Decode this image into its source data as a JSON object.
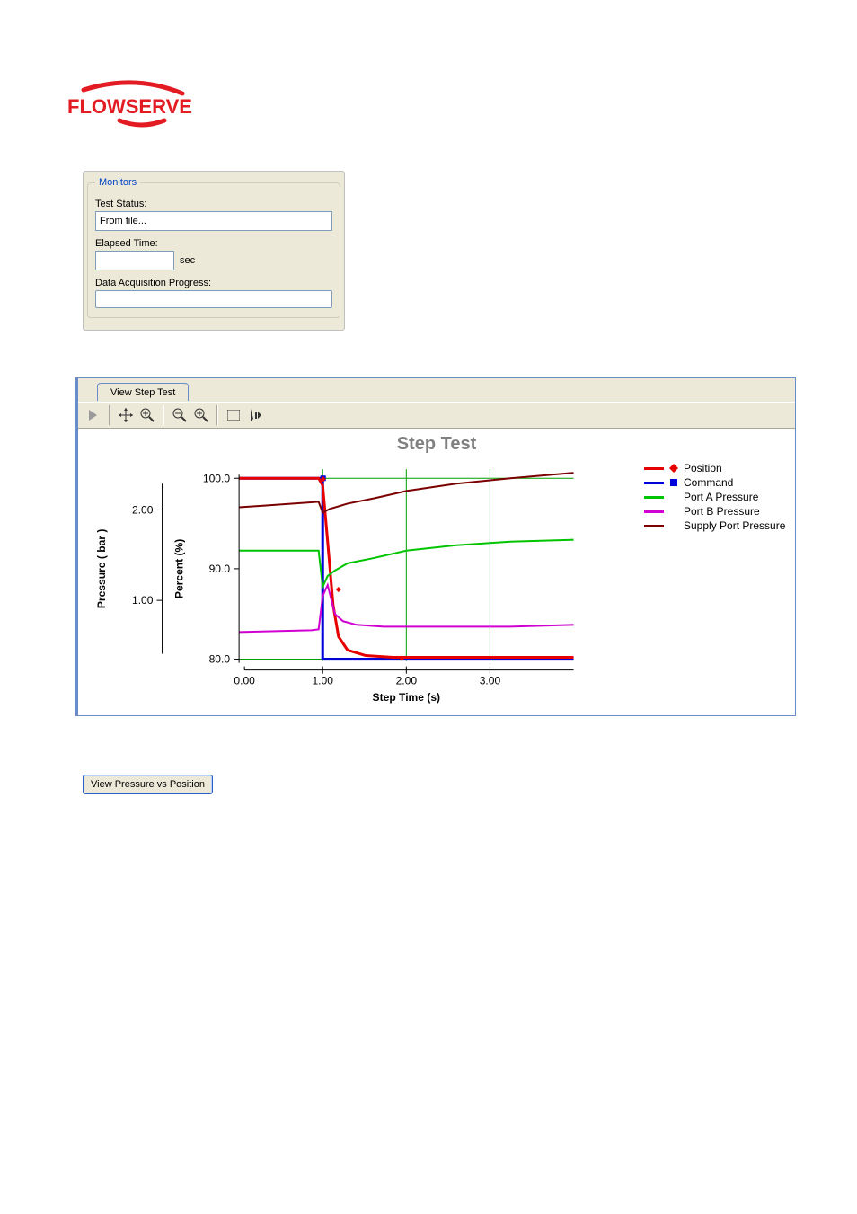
{
  "logo": {
    "text": "FLOWSERVE",
    "color": "#e31b23"
  },
  "monitors": {
    "title": "Monitors",
    "test_status_label": "Test Status:",
    "test_status_value": "From file...",
    "elapsed_label": "Elapsed Time:",
    "elapsed_value": "",
    "elapsed_unit": "sec",
    "daq_label": "Data Acquisition Progress:"
  },
  "chart": {
    "tab_label": "View Step Test",
    "title": "Step Test",
    "xlabel": "Step Time (s)",
    "y1label": "Pressure ( bar )",
    "y2label": "Percent (%)",
    "y1_ticks": [
      "1.00",
      "2.00"
    ],
    "y2_ticks": [
      "80.0",
      "90.0",
      "100.0"
    ],
    "x_ticks": [
      "0.00",
      "1.00",
      "2.00",
      "3.00"
    ],
    "legend": [
      {
        "name": "Position",
        "color": "#e60000",
        "marker": "diamond"
      },
      {
        "name": "Command",
        "color": "#0000d8",
        "marker": "square"
      },
      {
        "name": "Port A Pressure",
        "color": "#00c400"
      },
      {
        "name": "Port B Pressure",
        "color": "#d000d0"
      },
      {
        "name": "Supply Port Pressure",
        "color": "#7a0000"
      }
    ]
  },
  "chart_data": {
    "type": "line",
    "title": "Step Test",
    "xlabel": "Step Time (s)",
    "y_axes": [
      {
        "label": "Pressure ( bar )",
        "range": [
          0.5,
          2.5
        ]
      },
      {
        "label": "Percent (%)",
        "range": [
          78,
          102
        ]
      }
    ],
    "x": [
      0.0,
      0.2,
      0.4,
      0.6,
      0.8,
      0.9,
      1.0,
      1.05,
      1.1,
      1.2,
      1.4,
      1.6,
      2.0,
      2.5,
      3.0,
      3.5
    ],
    "series": [
      {
        "name": "Position",
        "axis": 1,
        "color": "#e60000",
        "values": [
          100.0,
          100.0,
          100.0,
          100.0,
          100.0,
          100.0,
          99.0,
          91.0,
          85.0,
          81.5,
          80.5,
          80.3,
          80.2,
          80.2,
          80.2,
          80.2
        ]
      },
      {
        "name": "Command",
        "axis": 1,
        "color": "#0000d8",
        "values": [
          100.0,
          100.0,
          100.0,
          100.0,
          100.0,
          100.0,
          80.0,
          80.0,
          80.0,
          80.0,
          80.0,
          80.0,
          80.0,
          80.0,
          80.0,
          80.0
        ]
      },
      {
        "name": "Port A Pressure",
        "axis": 0,
        "color": "#00c400",
        "values": [
          1.7,
          1.7,
          1.7,
          1.7,
          1.7,
          1.7,
          1.25,
          1.32,
          1.4,
          1.46,
          1.52,
          1.57,
          1.63,
          1.68,
          1.71,
          1.73
        ]
      },
      {
        "name": "Port B Pressure",
        "axis": 0,
        "color": "#d000d8",
        "values": [
          0.75,
          0.75,
          0.76,
          0.76,
          0.77,
          0.77,
          1.2,
          1.0,
          0.88,
          0.85,
          0.84,
          0.83,
          0.83,
          0.83,
          0.83,
          0.84
        ]
      },
      {
        "name": "Supply Port Pressure",
        "axis": 0,
        "color": "#7a0000",
        "values": [
          1.95,
          1.96,
          1.97,
          1.98,
          1.99,
          2.0,
          1.88,
          1.92,
          1.98,
          2.03,
          2.08,
          2.12,
          2.18,
          2.23,
          2.27,
          2.3
        ]
      }
    ]
  },
  "bottom_button": "View Pressure vs Position"
}
